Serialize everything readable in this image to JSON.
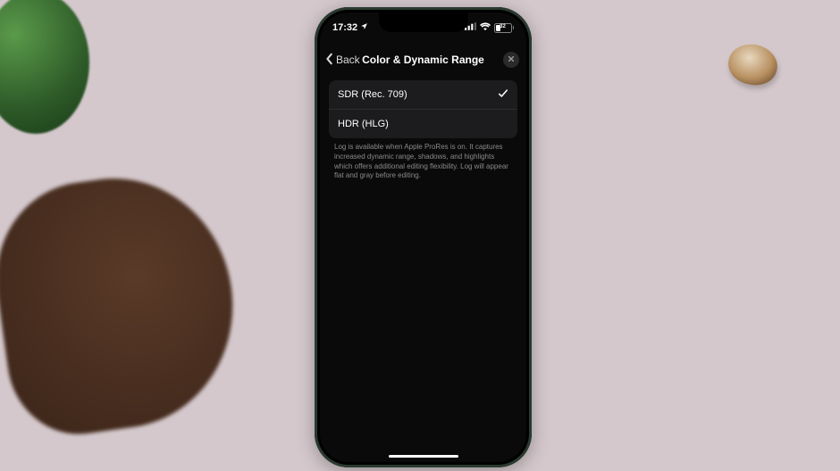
{
  "statusBar": {
    "time": "17:32",
    "battery": "32"
  },
  "nav": {
    "backLabel": "Back",
    "title": "Color & Dynamic Range"
  },
  "options": [
    {
      "label": "SDR (Rec. 709)",
      "selected": true
    },
    {
      "label": "HDR (HLG)",
      "selected": false
    }
  ],
  "footerText": "Log is available when Apple ProRes is on. It captures increased dynamic range, shadows, and highlights which offers additional editing flexibility. Log will appear flat and gray before editing."
}
